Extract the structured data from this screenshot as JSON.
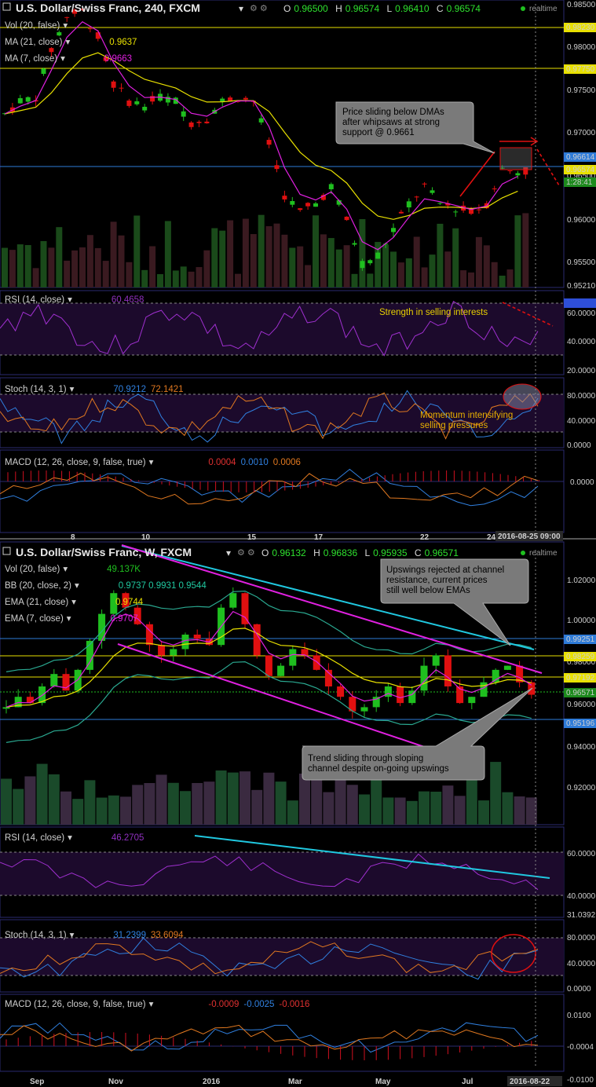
{
  "colors": {
    "up": "#1fbf1f",
    "down": "#e01010",
    "bg": "#000000",
    "grid": "#1a1a40",
    "yellow": "#e8e000",
    "magenta": "#e020e0",
    "cyan": "#20c8e0",
    "blue": "#2e7bd8",
    "orange": "#e07820",
    "callout": "#777777"
  },
  "top": {
    "title": "U.S. Dollar/Swiss Franc, 240, FXCM",
    "ohlc": {
      "o_label": "O",
      "o": "0.96500",
      "h_label": "H",
      "h": "0.96574",
      "l_label": "L",
      "l": "0.96410",
      "c_label": "C",
      "c": "0.96574"
    },
    "realtime": "realtime",
    "legend": [
      {
        "label": "Vol (20, false)",
        "value": "",
        "color": "#d0d0d0"
      },
      {
        "label": "MA (21, close)",
        "value": "0.9637",
        "color": "#e8e000"
      },
      {
        "label": "MA (7, close)",
        "value": "0.9663",
        "color": "#e020e0"
      }
    ],
    "price_ticks": [
      "0.98500",
      "0.98000",
      "0.97500",
      "0.97000",
      "0.96500",
      "0.96000",
      "0.95500",
      "0.95210"
    ],
    "price_tags": [
      {
        "label": "0.98230",
        "bg": "#e8e000",
        "fg": "#000"
      },
      {
        "label": "0.97750",
        "bg": "#e8e000",
        "fg": "#000"
      },
      {
        "label": "0.96614",
        "bg": "#2e7bd8",
        "fg": "#fff"
      },
      {
        "label": "0.96574",
        "bg": "#e8e000",
        "fg": "#000"
      },
      {
        "label": "1:28:41",
        "bg": "#1c8a1c",
        "fg": "#fff"
      }
    ],
    "callout": "Price sliding below DMAs after whipsaws at strong support @ 0.9661",
    "x_labels": [
      "8",
      "10",
      "15",
      "17",
      "22",
      "24"
    ],
    "x_cursor": "2016-08-25 09:00",
    "rsi": {
      "label": "RSI (14, close)",
      "value": "60.4658",
      "ticks": [
        "65.5940",
        "60.0000",
        "40.0000",
        "20.0000"
      ],
      "note": "Strength in selling interests"
    },
    "stoch": {
      "label": "Stoch (14, 3, 1)",
      "k": "70.9212",
      "d": "72.1421",
      "ticks": [
        "80.0000",
        "40.0000",
        "0.0000"
      ],
      "note": "Momentum intensifying selling pressures"
    },
    "macd": {
      "label": "MACD (12, 26, close, 9, false, true)",
      "v1": "0.0004",
      "v2": "0.0010",
      "v3": "0.0006",
      "ticks": [
        "0.0000"
      ]
    }
  },
  "bottom": {
    "title": "U.S. Dollar/Swiss Franc, W, FXCM",
    "ohlc": {
      "o_label": "O",
      "o": "0.96132",
      "h_label": "H",
      "h": "0.96836",
      "l_label": "L",
      "l": "0.95935",
      "c_label": "C",
      "c": "0.96571"
    },
    "realtime": "realtime",
    "legend": [
      {
        "label": "Vol (20, false)",
        "value": "49.137K",
        "color": "#1fbf1f"
      },
      {
        "label": "BB (20, close, 2)",
        "value": "0.9737  0.9931  0.9544",
        "color": "#20c8a0"
      },
      {
        "label": "EMA (21, close)",
        "value": "0.9744",
        "color": "#e8e000"
      },
      {
        "label": "EMA (7, close)",
        "value": "0.9707",
        "color": "#e020e0"
      }
    ],
    "price_ticks": [
      "1.02000",
      "1.00000",
      "0.98000",
      "0.96000",
      "0.94000",
      "0.92000"
    ],
    "price_tags": [
      {
        "label": "0.99251",
        "bg": "#2e7bd8",
        "fg": "#fff"
      },
      {
        "label": "0.98259",
        "bg": "#e8e000",
        "fg": "#000"
      },
      {
        "label": "0.97192",
        "bg": "#e8e000",
        "fg": "#000"
      },
      {
        "label": "0.96571",
        "bg": "#1c8a1c",
        "fg": "#fff"
      },
      {
        "label": "0.95196",
        "bg": "#2e7bd8",
        "fg": "#fff"
      }
    ],
    "callout_top": "Upswings rejected at channel resistance, current prices still well below EMAs",
    "callout_bottom": "Trend sliding through sloping channel despite on-going upswings",
    "x_labels": [
      "Sep",
      "Nov",
      "2016",
      "Mar",
      "May",
      "Jul"
    ],
    "x_cursor": "2016-08-22",
    "rsi": {
      "label": "RSI (14, close)",
      "value": "46.2705",
      "ticks": [
        "60.0000",
        "40.0000",
        "31.0392"
      ]
    },
    "stoch": {
      "label": "Stoch (14, 3, 1)",
      "k": "31.2399",
      "d": "33.6094",
      "ticks": [
        "80.0000",
        "40.0000",
        "0.0000"
      ]
    },
    "macd": {
      "label": "MACD (12, 26, close, 9, false, true)",
      "v1": "-0.0009",
      "v2": "-0.0025",
      "v3": "-0.0016",
      "ticks": [
        "0.0100",
        "-0.0004",
        "-0.0100"
      ]
    }
  },
  "chart_data": [
    {
      "type": "line",
      "title": "U.S. Dollar/Swiss Franc, 240, FXCM",
      "x": [
        "8",
        "10",
        "15",
        "17",
        "22",
        "24"
      ],
      "series": [
        {
          "name": "MA (21, close)",
          "values": [
            0.97,
            0.9815,
            0.9745,
            0.965,
            0.9585,
            0.9637
          ]
        },
        {
          "name": "MA (7, close)",
          "values": [
            0.974,
            0.9835,
            0.976,
            0.962,
            0.9605,
            0.9663
          ]
        }
      ],
      "ylim": [
        0.9521,
        0.985
      ]
    },
    {
      "type": "line",
      "title": "U.S. Dollar/Swiss Franc, W, FXCM",
      "x": [
        "Sep",
        "Nov",
        "2016",
        "Mar",
        "May",
        "Jul"
      ],
      "series": [
        {
          "name": "EMA (21, close)",
          "values": [
            0.965,
            0.98,
            0.995,
            0.98,
            0.974,
            0.9744
          ]
        },
        {
          "name": "EMA (7, close)",
          "values": [
            0.96,
            0.99,
            1.0,
            0.972,
            0.97,
            0.9707
          ]
        }
      ],
      "ylim": [
        0.91,
        1.03
      ]
    }
  ]
}
